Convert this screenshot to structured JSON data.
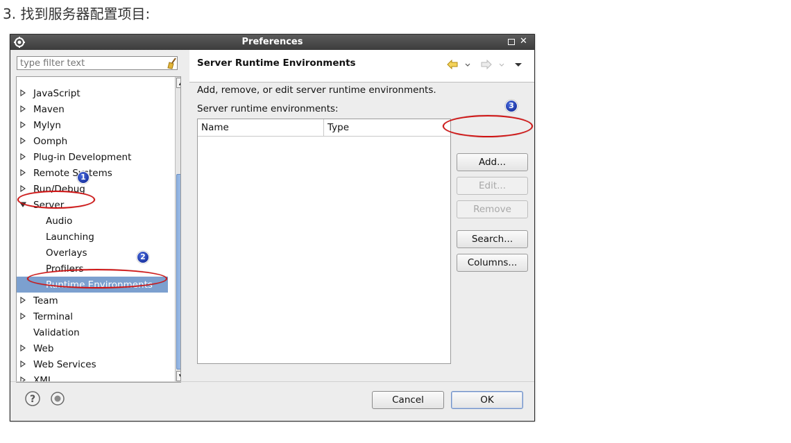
{
  "page_heading": "3. 找到服务器配置项目:",
  "dialog": {
    "title": "Preferences",
    "filter_placeholder": "type filter text",
    "tree_items": [
      {
        "label": "JavaScript",
        "expandable": true
      },
      {
        "label": "Maven",
        "expandable": true
      },
      {
        "label": "Mylyn",
        "expandable": true
      },
      {
        "label": "Oomph",
        "expandable": true
      },
      {
        "label": "Plug-in Development",
        "expandable": true
      },
      {
        "label": "Remote Systems",
        "expandable": true
      },
      {
        "label": "Run/Debug",
        "expandable": true
      },
      {
        "label": "Server",
        "expandable": true,
        "expanded": true
      },
      {
        "label": "Audio",
        "child": true
      },
      {
        "label": "Launching",
        "child": true
      },
      {
        "label": "Overlays",
        "child": true
      },
      {
        "label": "Profilers",
        "child": true
      },
      {
        "label": "Runtime Environments",
        "child": true,
        "selected": true
      },
      {
        "label": "Team",
        "expandable": true
      },
      {
        "label": "Terminal",
        "expandable": true
      },
      {
        "label": "Validation",
        "expandable": false
      },
      {
        "label": "Web",
        "expandable": true
      },
      {
        "label": "Web Services",
        "expandable": true
      },
      {
        "label": "XML",
        "expandable": true
      }
    ],
    "page_title": "Server Runtime Environments",
    "description": "Add, remove, or edit server runtime environments.",
    "list_label": "Server runtime environments:",
    "table_columns": [
      "Name",
      "Type"
    ],
    "buttons": {
      "add": "Add...",
      "edit": "Edit...",
      "remove": "Remove",
      "search": "Search...",
      "columns": "Columns..."
    },
    "footer": {
      "cancel": "Cancel",
      "ok": "OK"
    }
  },
  "annotations": {
    "badge_1": "1",
    "badge_2": "2",
    "badge_3": "3"
  },
  "colors": {
    "selection": "#7ca0cf",
    "annotation_red": "#d01515",
    "badge_blue": "#0a1f8a"
  }
}
